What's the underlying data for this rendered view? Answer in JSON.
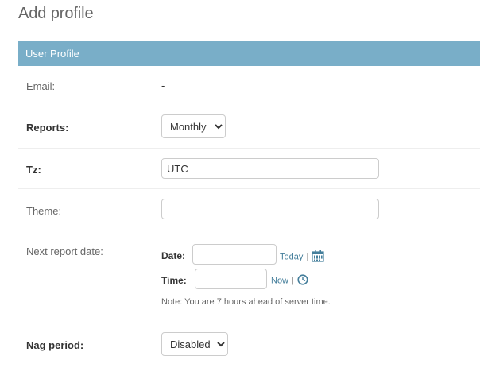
{
  "page": {
    "title": "Add profile"
  },
  "fieldset": {
    "caption": "User Profile"
  },
  "fields": {
    "email": {
      "label": "Email:",
      "value": "-"
    },
    "reports": {
      "label": "Reports:",
      "selected": "Monthly"
    },
    "tz": {
      "label": "Tz:",
      "value": "UTC",
      "placeholder": ""
    },
    "theme": {
      "label": "Theme:",
      "value": "",
      "placeholder": ""
    },
    "next_report_date": {
      "label": "Next report date:",
      "date_label": "Date:",
      "date_value": "",
      "today_link": "Today",
      "time_label": "Time:",
      "time_value": "",
      "now_link": "Now",
      "separator": "|",
      "note": "Note: You are 7 hours ahead of server time.",
      "calendar_icon": "calendar-icon",
      "clock_icon": "clock-icon"
    },
    "nag_period": {
      "label": "Nag period:",
      "selected": "Disabled"
    }
  },
  "colors": {
    "caption_bg": "#79aec8",
    "link": "#447e9b",
    "border": "#cccccc"
  }
}
